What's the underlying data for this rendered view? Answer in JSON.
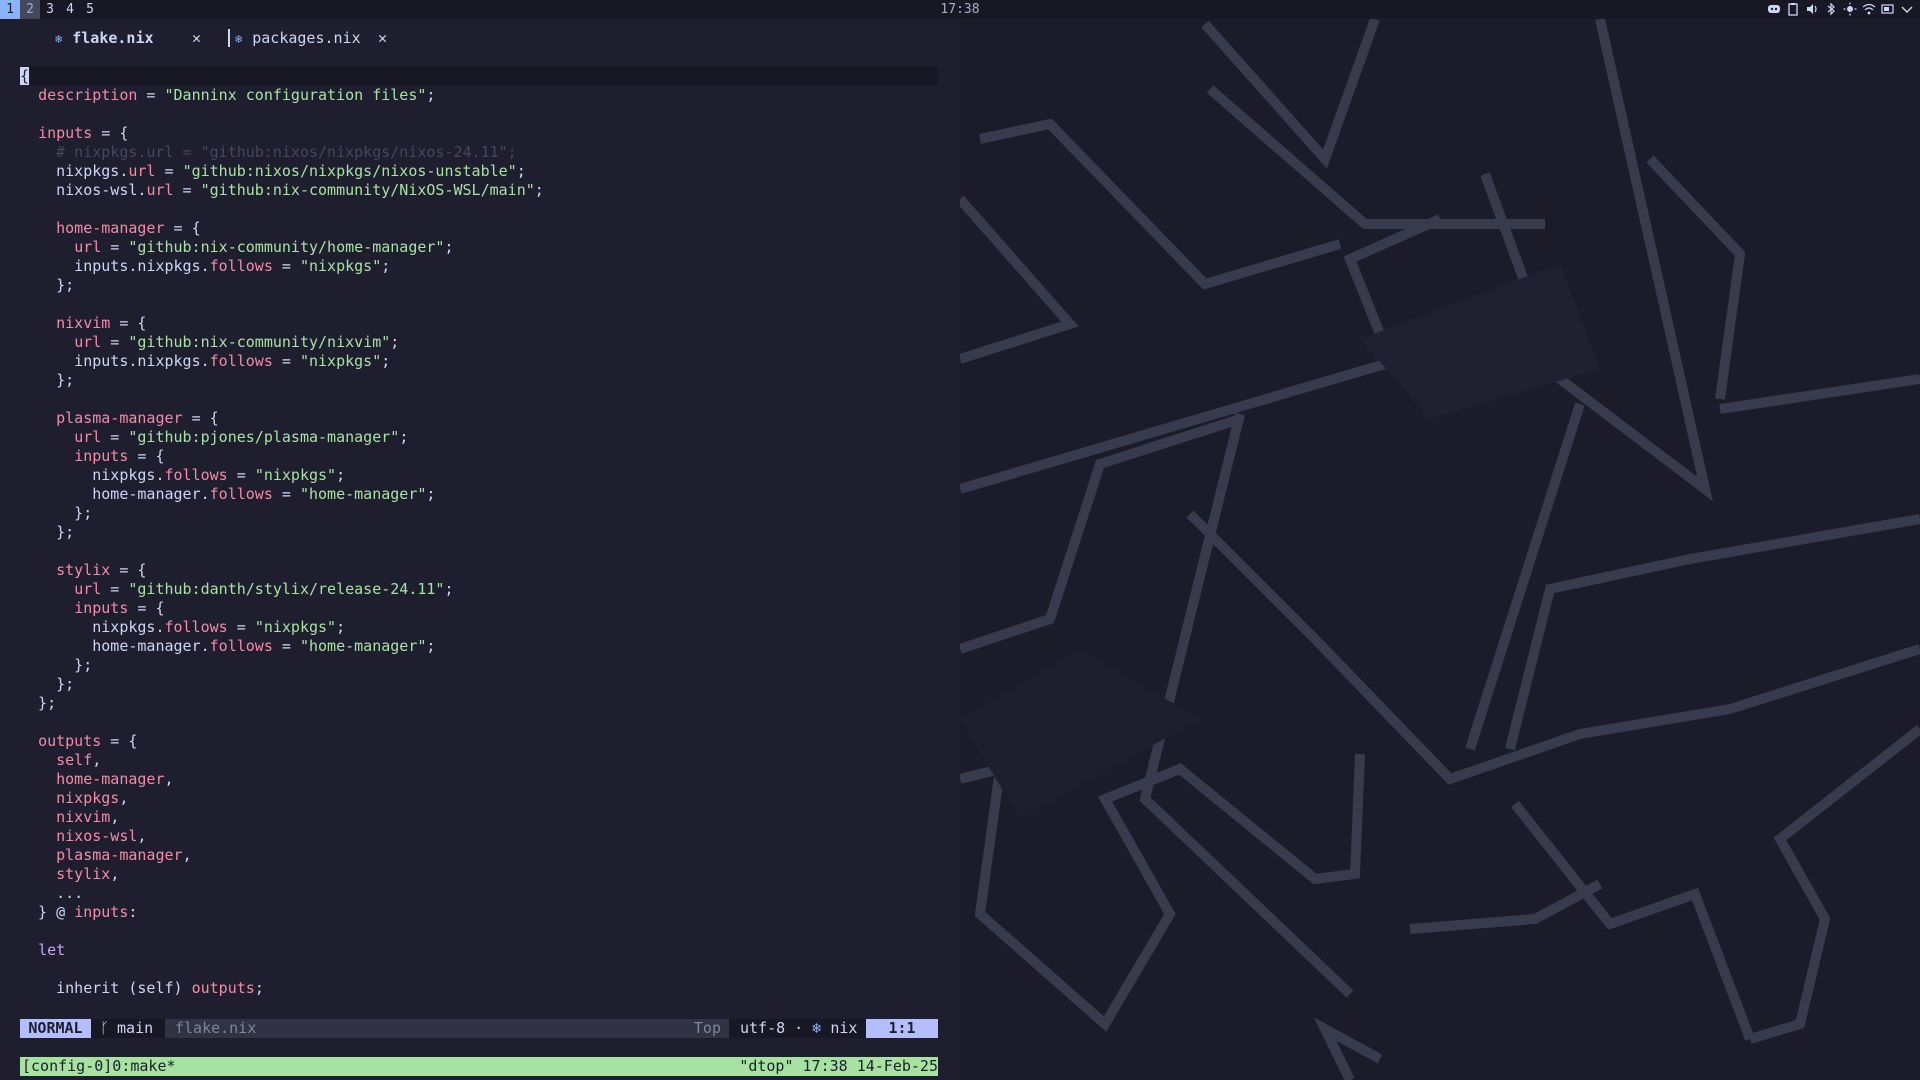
{
  "topbar": {
    "workspaces": [
      "1",
      "2",
      "3",
      "4",
      "5"
    ],
    "active_workspace": "1",
    "clock": "17:38",
    "tray_icons": [
      "discord-icon",
      "clipboard-icon",
      "volume-icon",
      "bluetooth-icon",
      "brightness-icon",
      "wifi-icon",
      "battery-icon",
      "chevron-down-icon"
    ]
  },
  "tabs": [
    {
      "label": "flake.nix",
      "close": "✕",
      "icon": "nix-snowflake-icon",
      "active": true
    },
    {
      "label": "packages.nix",
      "close": "✕",
      "icon": "nix-snowflake-icon",
      "active": false
    }
  ],
  "code_lines": [
    [
      [
        "p",
        "{"
      ]
    ],
    [
      [
        "p",
        "  "
      ],
      [
        "k",
        "description"
      ],
      [
        "p",
        " = "
      ],
      [
        "s",
        "\"Danninx configuration files\""
      ],
      [
        "p",
        ";"
      ]
    ],
    [],
    [
      [
        "p",
        "  "
      ],
      [
        "k",
        "inputs"
      ],
      [
        "p",
        " = {"
      ]
    ],
    [
      [
        "p",
        "    "
      ],
      [
        "c",
        "# nixpkgs.url = \"github:nixos/nixpkgs/nixos-24.11\";"
      ]
    ],
    [
      [
        "p",
        "    nixpkgs."
      ],
      [
        "k",
        "url"
      ],
      [
        "p",
        " = "
      ],
      [
        "s",
        "\"github:nixos/nixpkgs/nixos-unstable\""
      ],
      [
        "p",
        ";"
      ]
    ],
    [
      [
        "p",
        "    nixos-wsl."
      ],
      [
        "k",
        "url"
      ],
      [
        "p",
        " = "
      ],
      [
        "s",
        "\"github:nix-community/NixOS-WSL/main\""
      ],
      [
        "p",
        ";"
      ]
    ],
    [],
    [
      [
        "p",
        "    "
      ],
      [
        "k",
        "home-manager"
      ],
      [
        "p",
        " = {"
      ]
    ],
    [
      [
        "p",
        "      "
      ],
      [
        "k",
        "url"
      ],
      [
        "p",
        " = "
      ],
      [
        "s",
        "\"github:nix-community/home-manager\""
      ],
      [
        "p",
        ";"
      ]
    ],
    [
      [
        "p",
        "      inputs.nixpkgs."
      ],
      [
        "k",
        "follows"
      ],
      [
        "p",
        " = "
      ],
      [
        "s",
        "\"nixpkgs\""
      ],
      [
        "p",
        ";"
      ]
    ],
    [
      [
        "p",
        "    };"
      ]
    ],
    [],
    [
      [
        "p",
        "    "
      ],
      [
        "k",
        "nixvim"
      ],
      [
        "p",
        " = {"
      ]
    ],
    [
      [
        "p",
        "      "
      ],
      [
        "k",
        "url"
      ],
      [
        "p",
        " = "
      ],
      [
        "s",
        "\"github:nix-community/nixvim\""
      ],
      [
        "p",
        ";"
      ]
    ],
    [
      [
        "p",
        "      inputs.nixpkgs."
      ],
      [
        "k",
        "follows"
      ],
      [
        "p",
        " = "
      ],
      [
        "s",
        "\"nixpkgs\""
      ],
      [
        "p",
        ";"
      ]
    ],
    [
      [
        "p",
        "    };"
      ]
    ],
    [],
    [
      [
        "p",
        "    "
      ],
      [
        "k",
        "plasma-manager"
      ],
      [
        "p",
        " = {"
      ]
    ],
    [
      [
        "p",
        "      "
      ],
      [
        "k",
        "url"
      ],
      [
        "p",
        " = "
      ],
      [
        "s",
        "\"github:pjones/plasma-manager\""
      ],
      [
        "p",
        ";"
      ]
    ],
    [
      [
        "p",
        "      "
      ],
      [
        "k",
        "inputs"
      ],
      [
        "p",
        " = {"
      ]
    ],
    [
      [
        "p",
        "        nixpkgs."
      ],
      [
        "k",
        "follows"
      ],
      [
        "p",
        " = "
      ],
      [
        "s",
        "\"nixpkgs\""
      ],
      [
        "p",
        ";"
      ]
    ],
    [
      [
        "p",
        "        home-manager."
      ],
      [
        "k",
        "follows"
      ],
      [
        "p",
        " = "
      ],
      [
        "s",
        "\"home-manager\""
      ],
      [
        "p",
        ";"
      ]
    ],
    [
      [
        "p",
        "      };"
      ]
    ],
    [
      [
        "p",
        "    };"
      ]
    ],
    [],
    [
      [
        "p",
        "    "
      ],
      [
        "k",
        "stylix"
      ],
      [
        "p",
        " = {"
      ]
    ],
    [
      [
        "p",
        "      "
      ],
      [
        "k",
        "url"
      ],
      [
        "p",
        " = "
      ],
      [
        "s",
        "\"github:danth/stylix/release-24.11\""
      ],
      [
        "p",
        ";"
      ]
    ],
    [
      [
        "p",
        "      "
      ],
      [
        "k",
        "inputs"
      ],
      [
        "p",
        " = {"
      ]
    ],
    [
      [
        "p",
        "        nixpkgs."
      ],
      [
        "k",
        "follows"
      ],
      [
        "p",
        " = "
      ],
      [
        "s",
        "\"nixpkgs\""
      ],
      [
        "p",
        ";"
      ]
    ],
    [
      [
        "p",
        "        home-manager."
      ],
      [
        "k",
        "follows"
      ],
      [
        "p",
        " = "
      ],
      [
        "s",
        "\"home-manager\""
      ],
      [
        "p",
        ";"
      ]
    ],
    [
      [
        "p",
        "      };"
      ]
    ],
    [
      [
        "p",
        "    };"
      ]
    ],
    [
      [
        "p",
        "  };"
      ]
    ],
    [],
    [
      [
        "p",
        "  "
      ],
      [
        "k",
        "outputs"
      ],
      [
        "p",
        " = {"
      ]
    ],
    [
      [
        "p",
        "    "
      ],
      [
        "k",
        "self"
      ],
      [
        "p",
        ","
      ]
    ],
    [
      [
        "p",
        "    "
      ],
      [
        "k",
        "home-manager"
      ],
      [
        "p",
        ","
      ]
    ],
    [
      [
        "p",
        "    "
      ],
      [
        "k",
        "nixpkgs"
      ],
      [
        "p",
        ","
      ]
    ],
    [
      [
        "p",
        "    "
      ],
      [
        "k",
        "nixvim"
      ],
      [
        "p",
        ","
      ]
    ],
    [
      [
        "p",
        "    "
      ],
      [
        "k",
        "nixos-wsl"
      ],
      [
        "p",
        ","
      ]
    ],
    [
      [
        "p",
        "    "
      ],
      [
        "k",
        "plasma-manager"
      ],
      [
        "p",
        ","
      ]
    ],
    [
      [
        "p",
        "    "
      ],
      [
        "k",
        "stylix"
      ],
      [
        "p",
        ","
      ]
    ],
    [
      [
        "p",
        "    ..."
      ]
    ],
    [
      [
        "p",
        "  } @ "
      ],
      [
        "k",
        "inputs"
      ],
      [
        "p",
        ":"
      ]
    ],
    [],
    [
      [
        "p",
        "  "
      ],
      [
        "kw",
        "let"
      ]
    ],
    [],
    [
      [
        "p",
        "    inherit (self) "
      ],
      [
        "k",
        "outputs"
      ],
      [
        "p",
        ";"
      ]
    ]
  ],
  "statusline": {
    "mode": "NORMAL",
    "branch_icon": "",
    "branch": "main",
    "filename": "flake.nix",
    "position": "Top",
    "encoding": "utf-8 ·",
    "filetype_icon": "❄",
    "filetype": "nix",
    "line_col": "1:1"
  },
  "tmux": {
    "left": "[config-0]0:make*",
    "right": "\"dtop\" 17:38 14-Feb-25"
  },
  "colors": {
    "background": "#1e1e2e",
    "accent": "#b4befe",
    "tmux_bar": "#a6e3a1",
    "string": "#a6e3a1",
    "key": "#f38ba8",
    "keyword": "#cba6f7",
    "comment": "#45475a"
  }
}
